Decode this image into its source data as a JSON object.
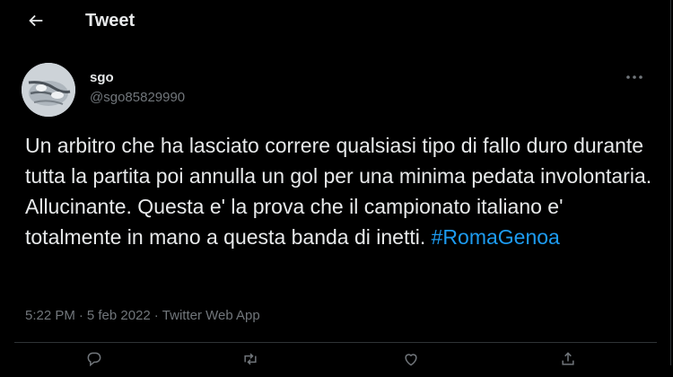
{
  "header": {
    "back_icon": "arrow-left-icon",
    "title": "Tweet"
  },
  "tweet": {
    "author": {
      "display_name": "sgo",
      "handle": "@sgo85829990",
      "avatar_icon": "avatar-image"
    },
    "more_icon": "more-horizontal-icon",
    "text": "Un arbitro che ha lasciato correre qualsiasi tipo di fallo duro durante tutta la partita poi annulla un gol per una minima pedata involontaria. Allucinante. Questa e' la prova che il campionato italiano e' totalmente in mano a questa banda di inetti. ",
    "hashtag": "#RomaGenoa",
    "time": "5:22 PM",
    "separator": "·",
    "date": "5 feb 2022",
    "source": "Twitter Web App"
  },
  "actions": [
    {
      "icon": "reply-icon"
    },
    {
      "icon": "retweet-icon"
    },
    {
      "icon": "like-icon"
    },
    {
      "icon": "share-icon"
    }
  ],
  "colors": {
    "background": "#000000",
    "text": "#e7e9ea",
    "secondary": "#71767b",
    "accent": "#1d9bf0",
    "border": "#2f3336"
  }
}
